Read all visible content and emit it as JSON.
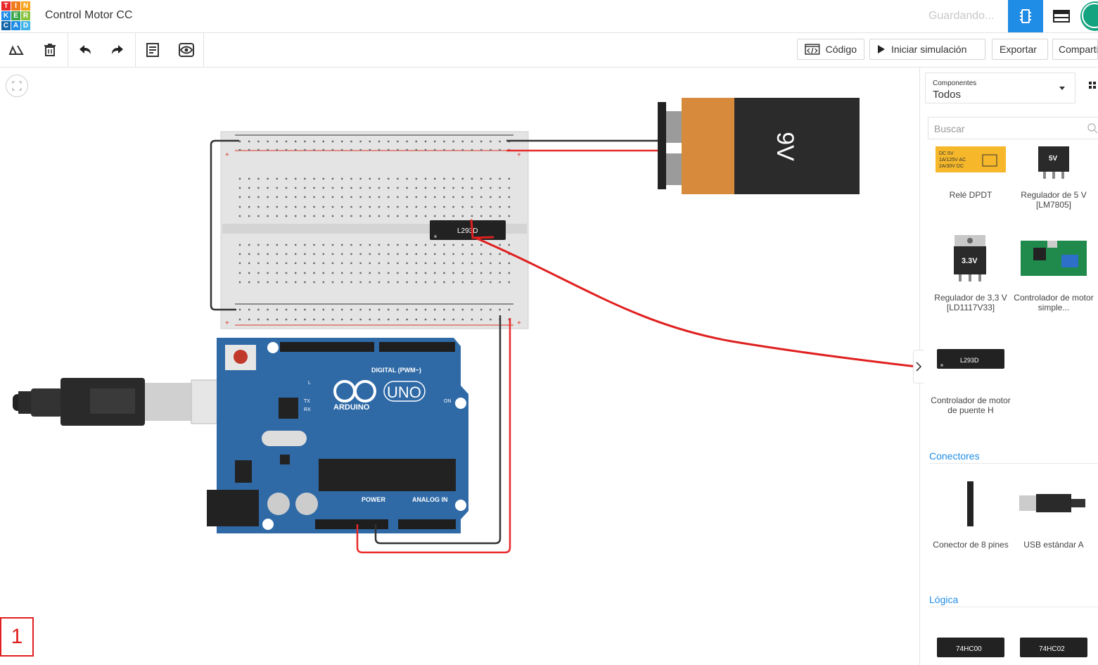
{
  "logo": {
    "letters": [
      "T",
      "I",
      "N",
      "K",
      "E",
      "R",
      "C",
      "A",
      "D"
    ]
  },
  "header": {
    "title": "Control Motor CC",
    "status": "Guardando..."
  },
  "toolbar": {
    "code_label": "Código",
    "simulate_label": "Iniciar simulación",
    "export_label": "Exportar",
    "share_label": "Compartir"
  },
  "panel": {
    "dropdown_caption": "Componentes",
    "dropdown_value": "Todos",
    "search_placeholder": "Buscar",
    "components": [
      {
        "name": "Relé DPDT"
      },
      {
        "name": "Regulador de 5 V [LM7805]"
      },
      {
        "name": "Regulador de 3,3 V [LD1117V33]"
      },
      {
        "name": "Controlador de motor simple..."
      },
      {
        "name": "Controlador de motor de puente H"
      }
    ],
    "sections": [
      {
        "title": "Conectores",
        "items": [
          {
            "name": "Conector de 8 pines"
          },
          {
            "name": "USB estándar A"
          }
        ]
      },
      {
        "title": "Lógica",
        "items": [
          {
            "chip": "74HC00"
          },
          {
            "chip": "74HC02"
          }
        ]
      }
    ]
  },
  "canvas": {
    "battery_label": "9V",
    "chip_label": "L293D",
    "relay_text": [
      "DC 5V",
      "1A/125V AC",
      "2A/30V DC"
    ],
    "reg5_text": "5V",
    "reg33_text": "3.3V",
    "arduino": {
      "brand": "ARDUINO",
      "model": "UNO",
      "digital_label": "DIGITAL (PWM~)",
      "power_label": "POWER",
      "analog_label": "ANALOG IN",
      "on_label": "ON",
      "tx_label": "TX",
      "rx_label": "RX",
      "l_label": "L"
    }
  },
  "step_badge": "1",
  "colors": {
    "accent": "#1f8ce6",
    "wire_red": "#e8292b",
    "wire_black": "#333333",
    "board_blue": "#2f6aa7",
    "annotation": "#e02020"
  }
}
